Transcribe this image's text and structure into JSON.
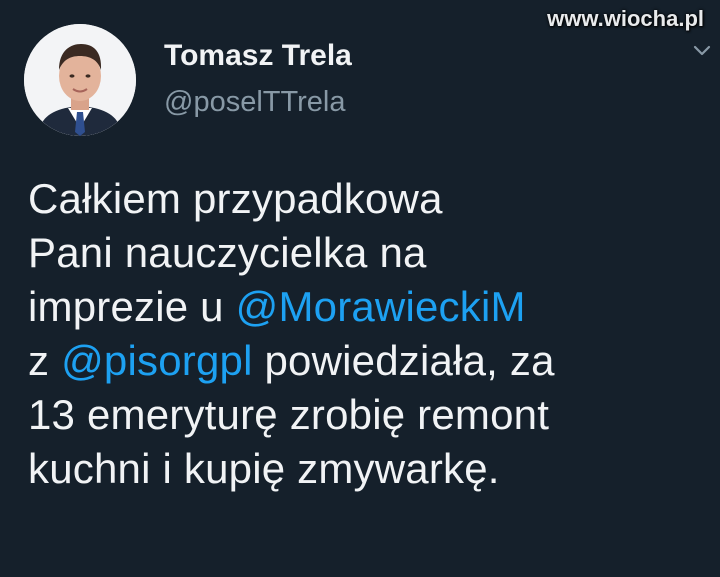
{
  "site": {
    "watermark": "www.wiocha.pl"
  },
  "author": {
    "display_name": "Tomasz Trela",
    "handle": "@poselTTrela"
  },
  "menu": {
    "icon": "chevron-down-icon"
  },
  "colors": {
    "background": "#15202b",
    "text": "#f1f3f5",
    "secondary": "#8899a6",
    "mention": "#1da1f2"
  },
  "tweet": {
    "lines": [
      {
        "text": "Całkiem przypadkowa"
      },
      {
        "text": "Pani nauczycielka na"
      },
      {
        "pre": "imprezie u ",
        "mention": "@MorawieckiM"
      },
      {
        "pre": "z ",
        "mention": "@pisorgpl",
        "post": " powiedziała, za"
      },
      {
        "text": "13 emeryturę zrobię remont"
      },
      {
        "text": "kuchni i kupię zmywarkę."
      }
    ]
  }
}
